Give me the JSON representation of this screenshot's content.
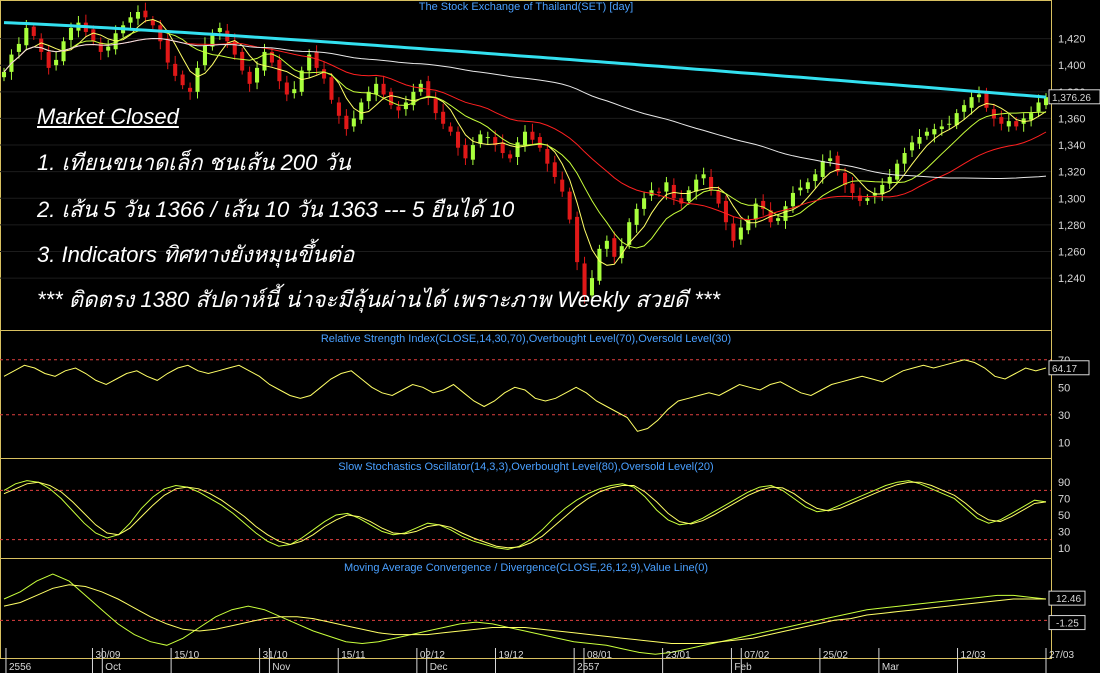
{
  "chart_data": [
    {
      "type": "candlestick",
      "title": "The Stock Exchange of Thailand(SET) [day]",
      "ylim": [
        1210,
        1440
      ],
      "yticks": [
        1240,
        1260,
        1280,
        1300,
        1320,
        1340,
        1360,
        1380,
        1400,
        1420
      ],
      "last_value": "1,376.26",
      "moving_averages": [
        {
          "name": "5-day",
          "color": "#ffff66"
        },
        {
          "name": "10-day",
          "color": "#c8ff3c"
        },
        {
          "name": "25-day",
          "color": "#ff2020"
        },
        {
          "name": "75-day",
          "color": "#e8e8e8"
        },
        {
          "name": "200-day",
          "color": "#33e0f0"
        }
      ],
      "candle_close_path": [
        1395,
        1408,
        1416,
        1428,
        1422,
        1410,
        1398,
        1404,
        1418,
        1428,
        1432,
        1425,
        1418,
        1410,
        1414,
        1424,
        1430,
        1436,
        1440,
        1436,
        1430,
        1418,
        1402,
        1392,
        1385,
        1380,
        1398,
        1415,
        1424,
        1428,
        1418,
        1408,
        1396,
        1386,
        1398,
        1410,
        1402,
        1388,
        1378,
        1382,
        1396,
        1408,
        1398,
        1390,
        1374,
        1362,
        1352,
        1360,
        1372,
        1380,
        1386,
        1378,
        1370,
        1366,
        1372,
        1380,
        1386,
        1376,
        1364,
        1356,
        1350,
        1338,
        1330,
        1340,
        1348,
        1346,
        1340,
        1334,
        1330,
        1342,
        1350,
        1344,
        1338,
        1326,
        1316,
        1305,
        1284,
        1252,
        1226,
        1240,
        1262,
        1268,
        1256,
        1264,
        1282,
        1292,
        1300,
        1306,
        1304,
        1312,
        1300,
        1296,
        1306,
        1314,
        1318,
        1306,
        1296,
        1282,
        1268,
        1278,
        1284,
        1296,
        1292,
        1282,
        1285,
        1294,
        1304,
        1308,
        1312,
        1318,
        1328,
        1330,
        1320,
        1310,
        1304,
        1298,
        1300,
        1304,
        1310,
        1316,
        1326,
        1334,
        1342,
        1346,
        1350,
        1352,
        1354,
        1356,
        1364,
        1370,
        1376,
        1378,
        1368,
        1360,
        1356,
        1358,
        1354,
        1360,
        1364,
        1372,
        1376
      ]
    },
    {
      "type": "line",
      "title": "Relative Strength Index(CLOSE,14,30,70),Overbought Level(70),Oversold Level(30)",
      "ylim": [
        0,
        80
      ],
      "yticks": [
        10,
        30,
        50,
        70
      ],
      "overbought": 70,
      "oversold": 30,
      "last_value": "64.17",
      "values": [
        58,
        62,
        66,
        64,
        60,
        58,
        62,
        64,
        60,
        55,
        52,
        56,
        60,
        62,
        58,
        55,
        60,
        64,
        66,
        62,
        60,
        62,
        64,
        66,
        62,
        58,
        52,
        48,
        44,
        42,
        44,
        50,
        56,
        60,
        62,
        56,
        50,
        46,
        44,
        48,
        52,
        50,
        46,
        48,
        52,
        46,
        40,
        36,
        40,
        46,
        50,
        48,
        42,
        40,
        42,
        46,
        50,
        46,
        40,
        36,
        32,
        28,
        18,
        20,
        26,
        34,
        40,
        42,
        44,
        46,
        44,
        48,
        52,
        50,
        48,
        52,
        54,
        50,
        46,
        44,
        48,
        52,
        54,
        56,
        58,
        56,
        54,
        58,
        62,
        64,
        66,
        64,
        66,
        68,
        70,
        68,
        64,
        58,
        56,
        60,
        64,
        62,
        64
      ]
    },
    {
      "type": "line",
      "title": "Slow Stochastics Oscillator(14,3,3),Overbought Level(80),Oversold Level(20)",
      "ylim": [
        0,
        100
      ],
      "yticks": [
        10,
        30,
        50,
        70,
        90
      ],
      "overbought": 80,
      "oversold": 20,
      "series": [
        {
          "color": "#c8ff3c",
          "values": [
            80,
            88,
            92,
            90,
            82,
            70,
            55,
            40,
            28,
            22,
            26,
            40,
            58,
            72,
            82,
            86,
            84,
            78,
            70,
            62,
            52,
            40,
            28,
            18,
            12,
            14,
            22,
            32,
            42,
            50,
            52,
            46,
            38,
            30,
            26,
            28,
            34,
            40,
            38,
            32,
            24,
            18,
            14,
            10,
            8,
            12,
            20,
            32,
            46,
            58,
            68,
            76,
            82,
            86,
            88,
            84,
            72,
            56,
            44,
            38,
            40,
            46,
            54,
            62,
            70,
            78,
            84,
            86,
            80,
            70,
            60,
            54,
            56,
            62,
            68,
            74,
            80,
            86,
            90,
            92,
            88,
            82,
            76,
            70,
            58,
            46,
            40,
            44,
            52,
            60,
            68,
            66
          ]
        },
        {
          "color": "#ffff66",
          "values": [
            76,
            82,
            88,
            90,
            86,
            78,
            66,
            52,
            38,
            28,
            26,
            34,
            48,
            62,
            74,
            82,
            84,
            82,
            76,
            68,
            58,
            48,
            36,
            26,
            18,
            14,
            18,
            26,
            36,
            44,
            50,
            48,
            42,
            34,
            28,
            27,
            30,
            36,
            38,
            35,
            28,
            22,
            17,
            12,
            10,
            11,
            16,
            24,
            36,
            48,
            60,
            70,
            78,
            83,
            86,
            86,
            78,
            66,
            52,
            42,
            39,
            43,
            50,
            58,
            66,
            74,
            80,
            84,
            83,
            76,
            66,
            58,
            55,
            58,
            64,
            70,
            76,
            82,
            87,
            90,
            90,
            86,
            80,
            74,
            64,
            52,
            44,
            42,
            48,
            56,
            64,
            66
          ]
        }
      ]
    },
    {
      "type": "line",
      "title": "Moving Average Convergence / Divergence(CLOSE,26,12,9),Value Line(0)",
      "ylim": [
        -20,
        26
      ],
      "zero_line": 0,
      "value_labels": [
        "12.46",
        "0",
        "-1.25"
      ],
      "series": [
        {
          "color": "#c8ff3c",
          "values": [
            12,
            16,
            22,
            26,
            22,
            14,
            6,
            -2,
            -8,
            -12,
            -14,
            -10,
            -4,
            2,
            6,
            8,
            6,
            2,
            -2,
            -6,
            -9,
            -12,
            -13,
            -12,
            -10,
            -8,
            -6,
            -4,
            -2,
            -1,
            -2,
            -4,
            -6,
            -8,
            -10,
            -12,
            -13,
            -14,
            -16,
            -18,
            -19,
            -18,
            -16,
            -14,
            -12,
            -10,
            -8,
            -6,
            -4,
            -2,
            0,
            2,
            4,
            6,
            7,
            8,
            9,
            10,
            11,
            12,
            13,
            14,
            14,
            13,
            12
          ]
        },
        {
          "color": "#ffff66",
          "values": [
            8,
            10,
            14,
            18,
            20,
            19,
            16,
            12,
            7,
            2,
            -2,
            -5,
            -6,
            -5,
            -3,
            -1,
            1,
            2,
            2,
            1,
            -1,
            -3,
            -5,
            -7,
            -8,
            -8,
            -8,
            -7,
            -6,
            -5,
            -4,
            -4,
            -4,
            -5,
            -6,
            -7,
            -8,
            -9,
            -10,
            -11,
            -12,
            -13,
            -13,
            -13,
            -12,
            -11,
            -10,
            -8,
            -6,
            -4,
            -2,
            0,
            1,
            3,
            4,
            5,
            6,
            7,
            8,
            9,
            10,
            11,
            12,
            12,
            12
          ]
        }
      ]
    }
  ],
  "date_axis": {
    "labels": [
      "2556",
      "30/09",
      "Oct",
      "15/10",
      "31/10",
      "Nov",
      "15/11",
      "02/12",
      "Dec",
      "19/12",
      "2557",
      "08/01",
      "23/01",
      "Feb",
      "07/02",
      "25/02",
      "Mar",
      "12/03",
      "27/03"
    ]
  },
  "annotation": {
    "heading": "Market Closed",
    "lines": [
      "1. เทียนขนาดเล็ก ชนเส้น 200 วัน",
      "2. เส้น 5 วัน 1366 / เส้น 10 วัน 1363 --- 5 ยืนได้ 10",
      "3. Indicators ทิศทางยังหมุนขึ้นต่อ",
      "*** ติดตรง 1380 สัปดาห์นี้ น่าจะมีลุ้นผ่านได้ เพราะภาพ Weekly สวยดี ***"
    ]
  },
  "colors": {
    "background": "#000000",
    "up_candle": "#a8ff3c",
    "down_candle": "#e01818",
    "panel_border": "#d8c060",
    "title_blue": "#4aa0ff",
    "level_line": "#e04040"
  }
}
